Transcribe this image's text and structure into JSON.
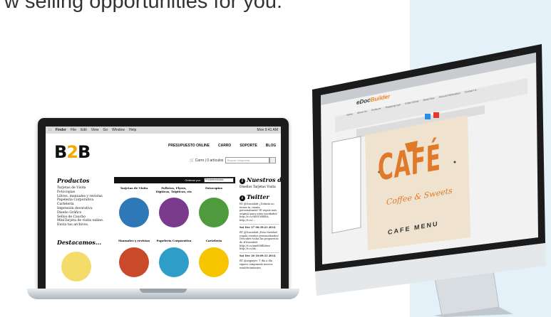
{
  "headline": "w selling opportunities for you.",
  "laptop": {
    "menubar": {
      "items": [
        "Finder",
        "File",
        "Edit",
        "View",
        "Go",
        "Window",
        "Help"
      ],
      "status": "Mon 9:41 AM"
    },
    "site": {
      "logo": {
        "left": "B",
        "mid": "2",
        "right": "B"
      },
      "nav": [
        "PRESUPUESTO ONLINE",
        "CARRO",
        "SOPORTE",
        "BLOG"
      ],
      "cart": "Carro | 0 artículos",
      "search_placeholder": "Buscar búsqueda",
      "products": {
        "heading": "Productos",
        "items": [
          "Tarjetas de Visita",
          "Fotocopias",
          "Libros, manuales y revistas",
          "Papelería Corporativa",
          "Cartelería",
          "Impresión decorativa",
          "Diseño Gráfico",
          "Sellos de Caucho",
          "MiniTarjeta de visita online. Envía tus archivos."
        ]
      },
      "destacamos": "Destacamos...",
      "order": {
        "label": "Ordenar por:",
        "value": "Predeterminado"
      },
      "categories": [
        {
          "name": "Tarjetas de Visita",
          "color": "#2e78b8"
        },
        {
          "name": "Folletos, Flyers, Dípticos, Trípticos, etc",
          "color": "#7a3b8c"
        },
        {
          "name": "Fotocopias",
          "color": "#4f9a3d"
        },
        {
          "name": "Manuales y revistas",
          "color": "#c94a2a"
        },
        {
          "name": "Papelería Corporativa",
          "color": "#2e9ec9"
        },
        {
          "name": "Cartelería",
          "color": "#f6c500"
        }
      ],
      "nuestros": {
        "heading": "Nuestros diseños",
        "sub": "Diseños Tarjetas Visita"
      },
      "twitter": {
        "heading": "Twitter",
        "tweets": [
          {
            "text": "RT @Yosoiskitt ¿Todavía no tienes tu cuenta personalizada? El regalo más original para estas navidades! http://t.co/0ESVWBfVA http://t.co/...",
            "date": "Sat Dec 27 06:39:23 2014"
          },
          {
            "text": "RT @Yosoiskitt ¡Esta Navidad regala cuentos personalizados! Descubre todas las propuestas de #Yosoiskitt http://t.co/mn8Mdlb8we http://t.co/dz...",
            "date": "Sat Dec 20 10:09:33 2014"
          },
          {
            "text": "RT @nojpayer: Y día a día siguen comprando nuevos establecimientos",
            "date": ""
          }
        ]
      }
    }
  },
  "imac": {
    "app_title_prefix": "eDoc",
    "app_title_suffix": "Builder",
    "cart": "Shopping Cart 0 items",
    "nav": [
      "Home",
      "About Us",
      "Products",
      "Shopping Cart",
      "Order Online",
      "Send Files",
      "Account Information",
      "Contact Us"
    ],
    "design": {
      "title": "CAFÉ",
      "subtitle": "Coffee & Sweets",
      "footer": "CAFE MENU"
    }
  },
  "colors": {
    "panel_bg": "#e4f1f8",
    "accent_orange": "#e07a2a",
    "logo_yellow": "#f2a900"
  }
}
